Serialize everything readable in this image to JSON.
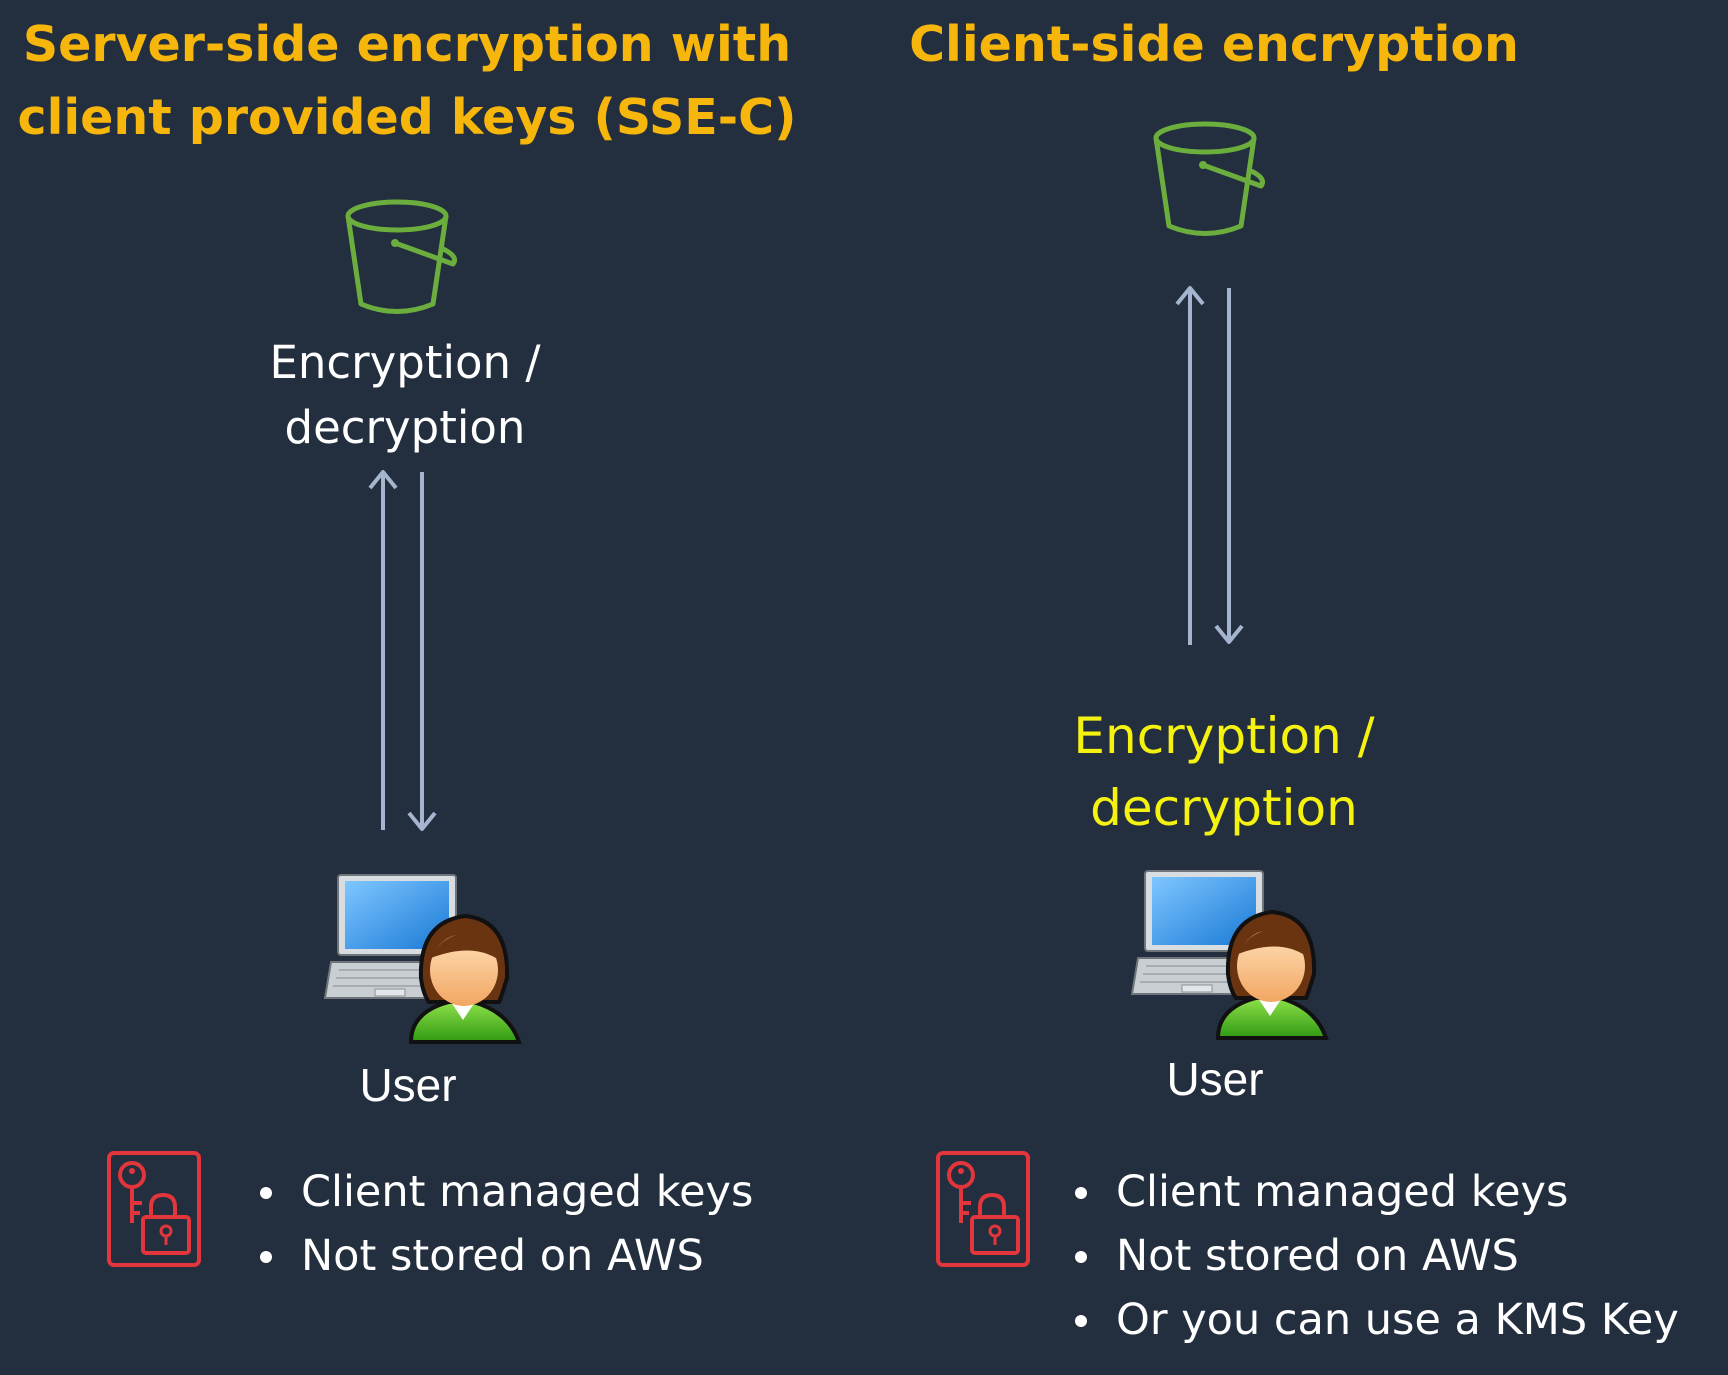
{
  "colors": {
    "background": "#232f3e",
    "title": "#f7b60c",
    "client_process_label": "#f5f210",
    "bucket": "#6cae3e",
    "arrow": "#a6b5cf",
    "key_icon": "#e3353c"
  },
  "left": {
    "title_line1": "Server-side encryption with",
    "title_line2": "client provided keys (SSE-C)",
    "process_line1": "Encryption /",
    "process_line2": "decryption",
    "user_label": "User",
    "bullets": [
      "Client managed keys",
      "Not stored on AWS"
    ]
  },
  "right": {
    "title": "Client-side encryption",
    "process_line1": "Encryption /",
    "process_line2": "decryption",
    "user_label": "User",
    "bullets": [
      "Client managed keys",
      "Not stored on AWS",
      "Or you can use a KMS Key"
    ]
  },
  "icons": {
    "bucket": "s3-bucket-icon",
    "arrows": "bidirectional-arrows-icon",
    "user": "user-laptop-icon",
    "key": "key-lock-icon"
  }
}
